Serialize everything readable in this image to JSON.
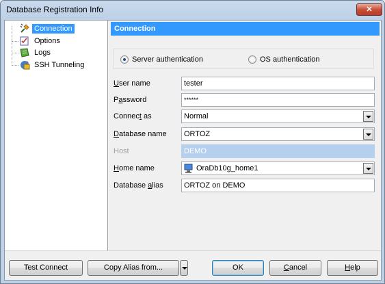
{
  "window": {
    "title": "Database Registration Info",
    "close_glyph": "✕"
  },
  "nav": {
    "items": [
      {
        "label": "Connection",
        "icon": "connection-plug-icon",
        "selected": true
      },
      {
        "label": "Options",
        "icon": "options-checklist-icon",
        "selected": false
      },
      {
        "label": "Logs",
        "icon": "logs-icon",
        "selected": false
      },
      {
        "label": "SSH Tunneling",
        "icon": "ssh-lock-icon",
        "selected": false
      }
    ]
  },
  "connection": {
    "header": "Connection",
    "auth": {
      "server": "Server authentication",
      "os": "OS authentication",
      "selected": "server"
    },
    "fields": {
      "user_name": {
        "label": "User name",
        "value": "tester"
      },
      "password": {
        "label": "Password",
        "value": "******"
      },
      "connect_as": {
        "label": "Connect as",
        "value": "Normal"
      },
      "database_name": {
        "label": "Database name",
        "value": "ORTOZ"
      },
      "host": {
        "label": "Host",
        "value": "DEMO"
      },
      "home_name": {
        "label": "Home name",
        "value": "OraDb10g_home1"
      },
      "database_alias": {
        "label": "Database alias",
        "value": "ORTOZ on DEMO"
      }
    }
  },
  "buttons": {
    "test_connect": "Test Connect",
    "copy_alias": "Copy Alias from...",
    "ok": "OK",
    "cancel": "Cancel",
    "help": "Help"
  },
  "colors": {
    "accent": "#3399ff",
    "disabled_field": "#b5d0ef"
  }
}
